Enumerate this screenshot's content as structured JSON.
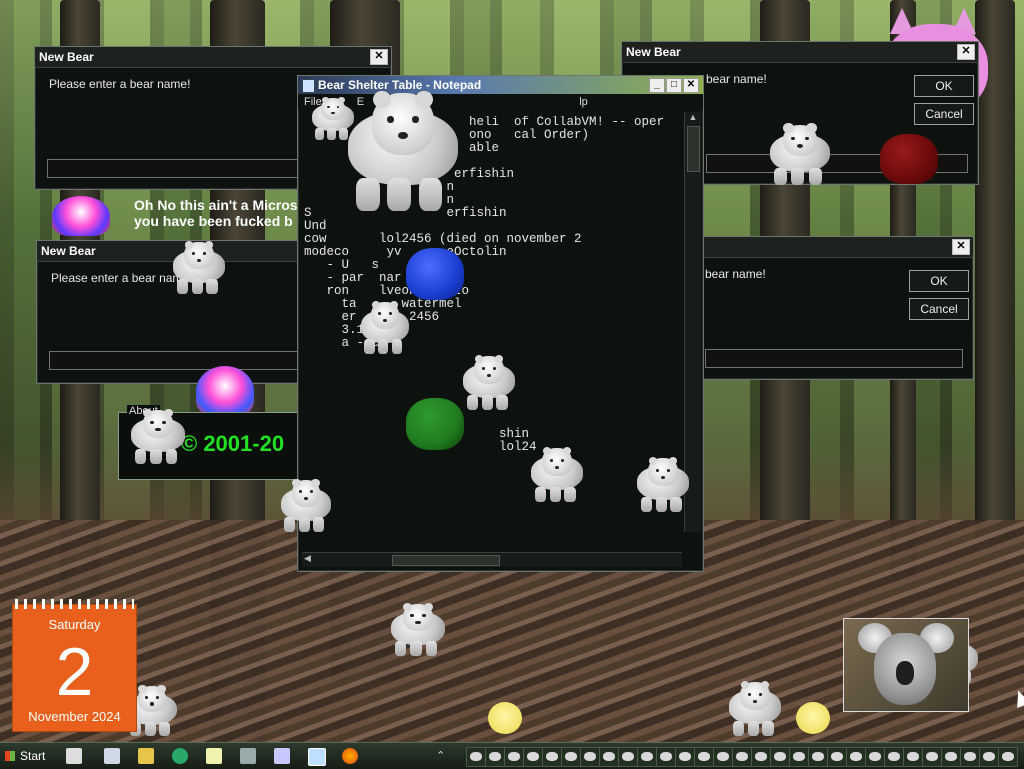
{
  "desktop": {
    "warning_text_line1": "Oh No this ain't a Micros",
    "warning_text_line2": "you have been fucked b",
    "about": {
      "label": "About",
      "copyright": "© 2001-20"
    }
  },
  "dialogs": [
    {
      "title": "New Bear",
      "prompt": "Please enter a bear name!",
      "close": "✕"
    },
    {
      "title": "New Bear",
      "prompt": "Please enter a bear name!",
      "close": "✕"
    },
    {
      "title": "New Bear",
      "prompt": "bear name!",
      "ok": "OK",
      "cancel": "Cancel",
      "close": "✕"
    },
    {
      "title": "",
      "prompt": "bear name!",
      "ok": "OK",
      "cancel": "Cancel",
      "close": "✕"
    }
  ],
  "notepad": {
    "title": "Bear Shelter Table - Notepad",
    "menu": [
      "File",
      "E",
      "lp"
    ],
    "content_lines": [
      "                      heli  of CollabVM! -- oper",
      "                      ono   cal Order)",
      "                      able",
      "",
      "                    erfishin",
      "                   n",
      "                   n",
      "S                  erfishin",
      "Und",
      "cow       lol2456 (died on november 2",
      "modeco     yv      eOctolin",
      "   - U   s",
      "   - par  nar",
      "   ron    lveonTheOcto",
      "     ta      watermel",
      "     er       2456",
      "     3.1",
      "     a - e",
      "",
      "",
      "",
      "",
      "",
      "",
      "                          shin",
      "                          lol24"
    ]
  },
  "calendar": {
    "day": "Saturday",
    "date": "2",
    "month": "November 2024"
  },
  "taskbar": {
    "start": "Start",
    "slot_count": 29
  },
  "colors": {
    "calendar": "#e8601c",
    "about_text": "#22e022",
    "blue_blob": "#1a3ed0",
    "green_blob": "#1f7a1f",
    "red_blob": "#6a0a0a"
  }
}
